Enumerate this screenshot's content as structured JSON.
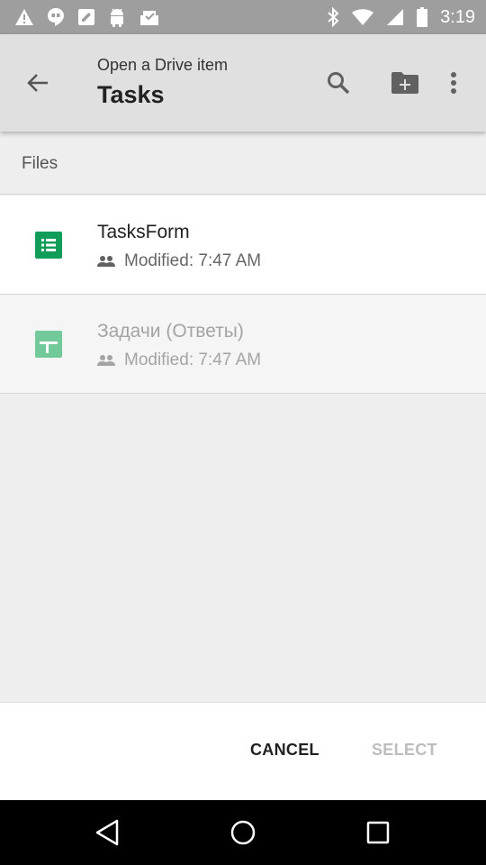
{
  "status_bar": {
    "time": "3:19",
    "left_icons": [
      "warning-icon",
      "hangouts-icon",
      "edit-box-icon",
      "android-icon",
      "inbox-check-icon"
    ],
    "right_icons": [
      "bluetooth-icon",
      "wifi-icon",
      "signal-icon",
      "battery-icon"
    ]
  },
  "app_bar": {
    "subtitle": "Open a Drive item",
    "title": "Tasks",
    "color": "#e0e0e0"
  },
  "section": {
    "label": "Files"
  },
  "files": [
    {
      "name": "TasksForm",
      "modified": "Modified: 7:47 AM",
      "icon": "forms-icon",
      "color": "#0f9d58",
      "enabled": true
    },
    {
      "name": "Задачи (Ответы)",
      "modified": "Modified: 7:47 AM",
      "icon": "sheets-icon",
      "color": "#72c99a",
      "enabled": false
    }
  ],
  "actions": {
    "cancel_label": "CANCEL",
    "select_label": "SELECT"
  },
  "nav_bar": {
    "icons": [
      "nav-back-icon",
      "nav-home-icon",
      "nav-recents-icon"
    ]
  }
}
